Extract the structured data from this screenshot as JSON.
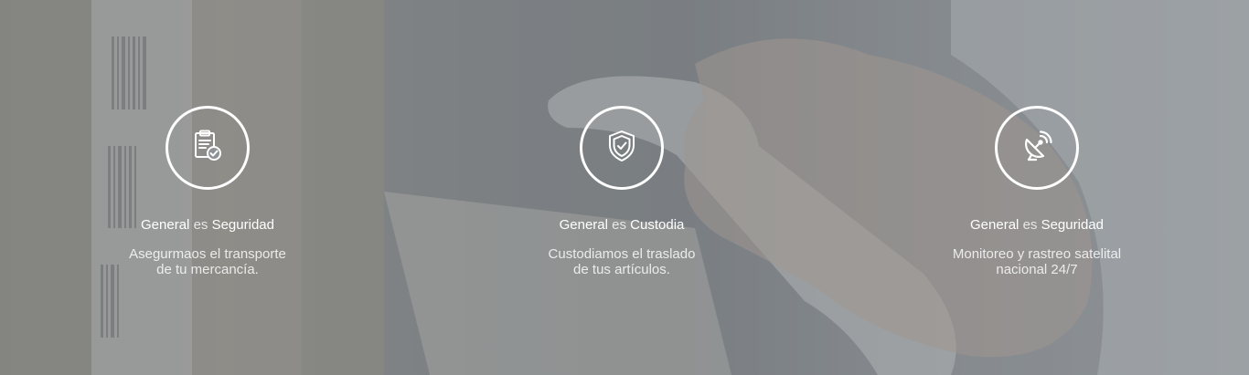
{
  "features": [
    {
      "icon": "clipboard-check-icon",
      "title_bold": "General",
      "title_connector": "es",
      "title_topic": "Seguridad",
      "desc_line1": "Asegurmaos el transporte",
      "desc_line2": "de tu mercancía."
    },
    {
      "icon": "shield-check-icon",
      "title_bold": "General",
      "title_connector": "es",
      "title_topic": "Custodia",
      "desc_line1": "Custodiamos el traslado",
      "desc_line2": "de tus artículos."
    },
    {
      "icon": "satellite-dish-icon",
      "title_bold": "General",
      "title_connector": "es",
      "title_topic": "Seguridad",
      "desc_line1": "Monitoreo y rastreo satelital",
      "desc_line2": "nacional 24/7"
    }
  ],
  "colors": {
    "text": "#ffffff",
    "overlay": "#5c6064"
  }
}
